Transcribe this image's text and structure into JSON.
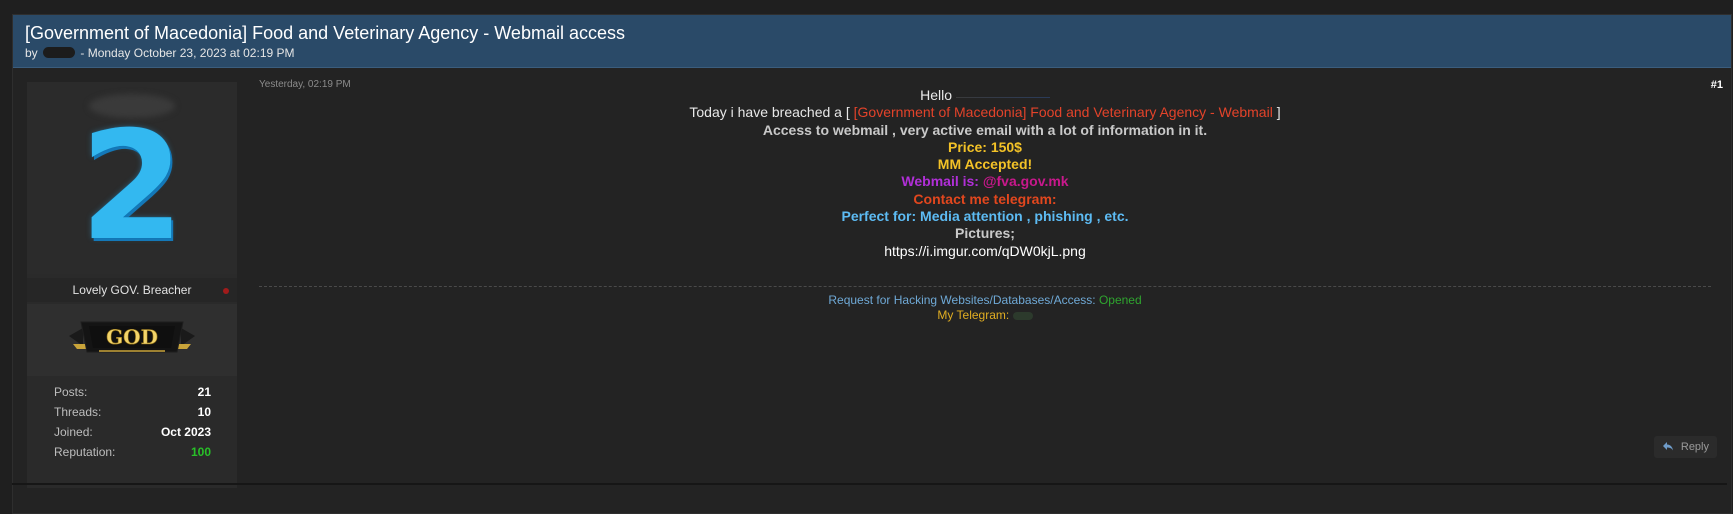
{
  "thread": {
    "title": "[Government of Macedonia] Food and Veterinary Agency - Webmail access",
    "by_prefix": "by",
    "date_line": "- Monday October 23, 2023 at 02:19 PM"
  },
  "user": {
    "avatar_glyph": "2",
    "rank": "Lovely GOV. Breacher",
    "badge_text": "GOD",
    "stats": [
      {
        "label": "Posts:",
        "value": "21"
      },
      {
        "label": "Threads:",
        "value": "10"
      },
      {
        "label": "Joined:",
        "value": "Oct 2023"
      },
      {
        "label": "Reputation:",
        "value": "100"
      }
    ]
  },
  "post": {
    "date": "Yesterday, 02:19 PM",
    "number": "#1",
    "hello": "Hello",
    "breach_prefix": "Today i have breached a  [",
    "breach_target": "[Government of Macedonia] Food and Veterinary Agency  - Webmail",
    "breach_suffix": "]",
    "access_line": "Access to webmail , very active email with a lot of information in it.",
    "price": "Price: 150$",
    "mm": "MM Accepted!",
    "webmail_label": "Webmail is:",
    "webmail_value": "@fva.gov.mk",
    "contact": "Contact me telegram:",
    "perfect_for": "Perfect for: Media attention , phishing , etc.",
    "pictures_label": "Pictures;",
    "pictures_link": "https://i.imgur.com/qDW0kjL.png"
  },
  "signature": {
    "request_label": "Request for Hacking Websites/Databases/Access:",
    "request_status": "Opened",
    "telegram_label": "My Telegram:"
  },
  "actions": {
    "reply_label": "Reply"
  },
  "colors": {
    "header_bg": "#2a4a68",
    "accent_red": "#e3432a",
    "gold": "#f3c227",
    "blue": "#5dbbf3",
    "purple": "#b12fd8",
    "green": "#28c028"
  },
  "icons": {
    "reply": "reply-arrow-icon",
    "status": "offline-dot-icon"
  }
}
